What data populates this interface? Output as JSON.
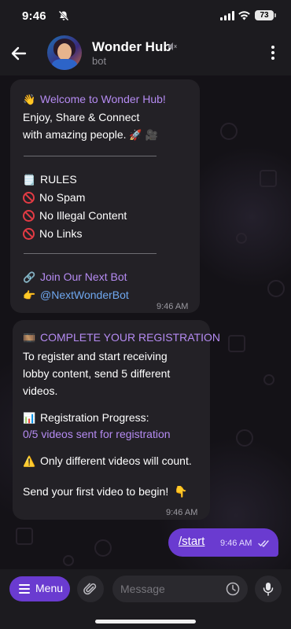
{
  "status_bar": {
    "time": "9:46",
    "battery": "73"
  },
  "header": {
    "title": "Wonder Hub",
    "subtitle": "bot"
  },
  "messages": {
    "welcome": {
      "greeting": "Welcome to Wonder Hub!",
      "line1": "Enjoy, Share & Connect",
      "line2": "with amazing people.",
      "rules_title": "RULES",
      "rules": [
        "No Spam",
        "No Illegal Content",
        "No Links"
      ],
      "join_label": "Join Our Next Bot",
      "bot_handle": "@NextWonderBot",
      "time": "9:46 AM"
    },
    "registration": {
      "title": "COMPLETE YOUR REGISTRATION",
      "body": [
        "To register and start receiving",
        "lobby content, send 5 different",
        "videos."
      ],
      "progress_label": "Registration Progress:",
      "progress_value": "0/5 videos sent for registration",
      "warning": "Only different videos will count.",
      "cta": "Send your first video to begin!",
      "time": "9:46 AM"
    },
    "outgoing": {
      "text": "/start",
      "time": "9:46 AM"
    }
  },
  "input_bar": {
    "menu_label": "Menu",
    "placeholder": "Message"
  },
  "colors": {
    "accent": "#b58bf2",
    "link": "#6fa8f0",
    "button": "#6a3bd0",
    "bubble": "#232126"
  }
}
